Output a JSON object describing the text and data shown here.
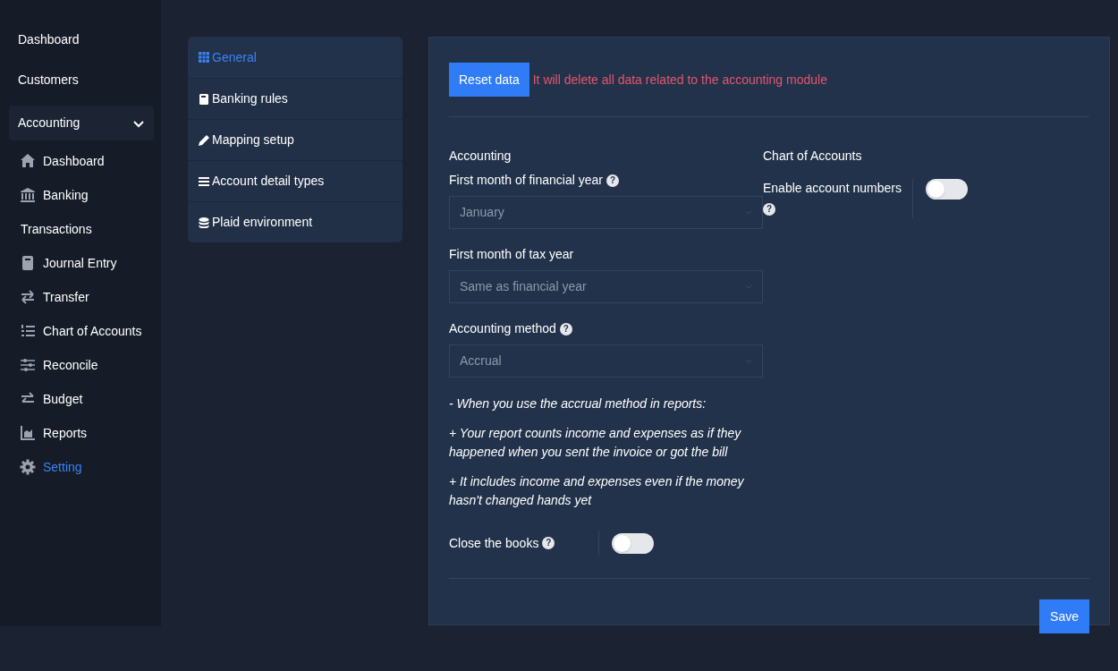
{
  "sidebar": {
    "items": [
      {
        "label": "Dashboard",
        "selected": false
      },
      {
        "label": "Customers",
        "selected": false
      },
      {
        "label": "Accounting",
        "selected": false,
        "expanded": true,
        "children": [
          {
            "label": "Dashboard",
            "selected": false
          },
          {
            "label": "Banking",
            "selected": false
          },
          {
            "label": "Transactions",
            "selected": false
          },
          {
            "label": "Journal Entry",
            "selected": false
          },
          {
            "label": "Transfer",
            "selected": false
          },
          {
            "label": "Chart of Accounts",
            "selected": false
          },
          {
            "label": "Reconcile",
            "selected": false
          },
          {
            "label": "Budget",
            "selected": false
          },
          {
            "label": "Reports",
            "selected": false
          },
          {
            "label": "Setting",
            "selected": true
          }
        ]
      }
    ]
  },
  "settings_nav": {
    "items": [
      {
        "label": "General",
        "selected": true
      },
      {
        "label": "Banking rules",
        "selected": false
      },
      {
        "label": "Mapping setup",
        "selected": false
      },
      {
        "label": "Account detail types",
        "selected": false
      },
      {
        "label": "Plaid environment",
        "selected": false
      }
    ]
  },
  "panel": {
    "reset_button": "Reset data",
    "reset_warning": "It will delete all data related to the accounting module",
    "accounting": {
      "heading": "Accounting",
      "fields": [
        {
          "label": "First month of financial year",
          "help": "?",
          "value": "January"
        },
        {
          "label": "First month of tax year",
          "value": "Same as financial year"
        },
        {
          "label": "Accounting method",
          "help": "?",
          "value": "Accrual"
        }
      ],
      "notes": [
        "- When you use the accrual method in reports:",
        "+ Your report counts income and expenses as if they happened when you sent the invoice or got the bill",
        "+ It includes income and expenses even if the money hasn't changed hands yet"
      ],
      "close_books": {
        "label": "Close the books",
        "help": "?",
        "on": false
      }
    },
    "chart_of_accounts": {
      "heading": "Chart of Accounts",
      "enable_numbers": {
        "label": "Enable account numbers",
        "help": "?",
        "on": false
      }
    },
    "save_button": "Save"
  }
}
